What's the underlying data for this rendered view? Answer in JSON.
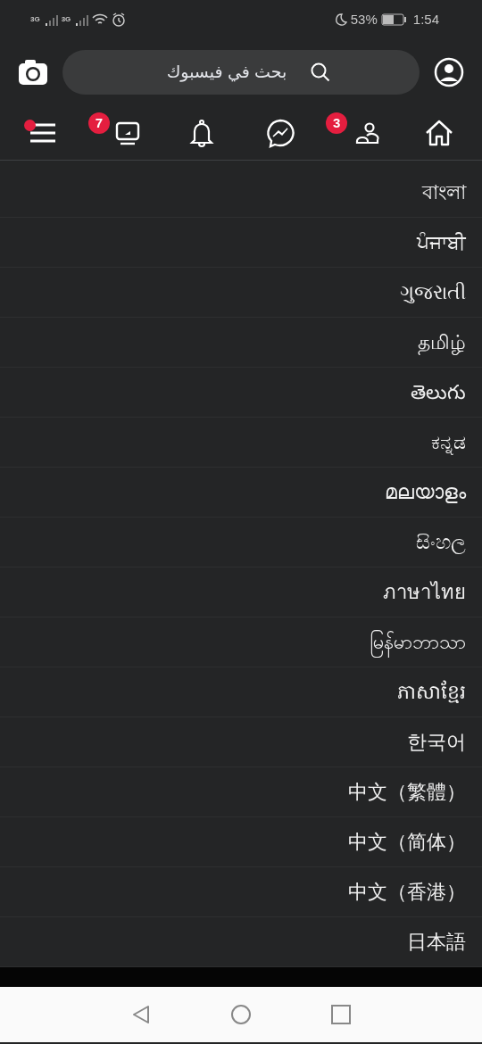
{
  "status_bar": {
    "network_1": "3G",
    "network_2": "3G",
    "battery": "53%",
    "time": "1:54"
  },
  "search": {
    "placeholder": "بحث في فيسبوك"
  },
  "nav_tabs": [
    {
      "kind": "menu",
      "dot": true
    },
    {
      "kind": "watch",
      "badge": "7"
    },
    {
      "kind": "bell"
    },
    {
      "kind": "messenger"
    },
    {
      "kind": "friends",
      "badge": "3"
    },
    {
      "kind": "home"
    }
  ],
  "languages": [
    "বাংলা",
    "ਪੰਜਾਬੀ",
    "ગુજરાતી",
    "தமிழ்",
    "తెలుగు",
    "ಕನ್ನಡ",
    "മലയാളം",
    "සිංහල",
    "ภาษาไทย",
    "မြန်မာဘာသာ",
    "ភាសាខ្មែរ",
    "한국어",
    "中文（繁體）",
    "中文（简体）",
    "中文（香港）",
    "日本語"
  ],
  "system_nav": [
    {
      "kind": "back"
    },
    {
      "kind": "home"
    },
    {
      "kind": "recents"
    }
  ]
}
